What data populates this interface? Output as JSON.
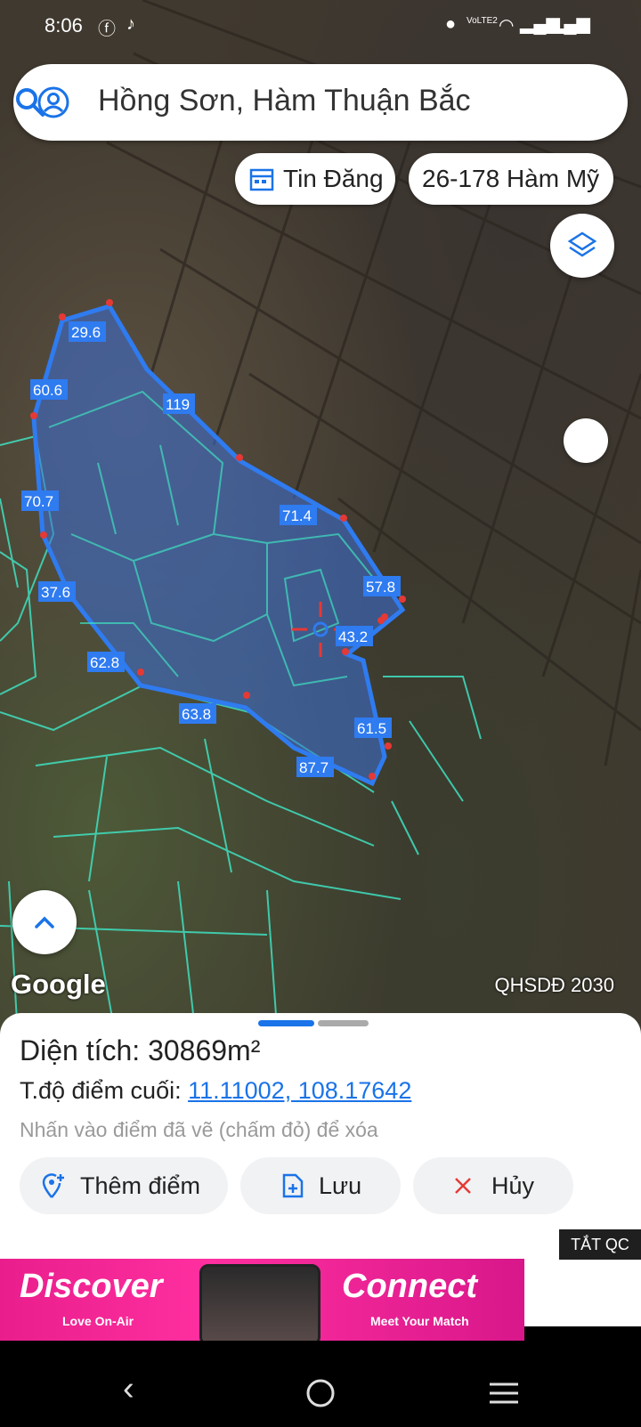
{
  "status": {
    "time": "8:06",
    "icons": [
      "facebook-icon",
      "tiktok-icon",
      "location-icon",
      "lte-icon",
      "wifi-icon",
      "signal-icon",
      "signal-icon",
      "battery-icon"
    ],
    "lte_label": "VoLTE2"
  },
  "search": {
    "text": "Hồng Sơn, Hàm Thuận Bắc",
    "left_icon": "account-icon",
    "right_icon": "search-icon"
  },
  "chips": {
    "tin_dang": "Tin Đăng",
    "address": "26-178 Hàm Mỹ"
  },
  "map": {
    "google": "Google",
    "plan_label": "QHSDĐ 2030",
    "edge_labels": [
      "29.6",
      "119",
      "60.6",
      "70.7",
      "71.4",
      "57.8",
      "43.2",
      "37.6",
      "62.8",
      "63.8",
      "61.5",
      "87.7"
    ],
    "colors": {
      "polygon_fill": "#3a6fd8",
      "polygon_stroke": "#2f7bf0",
      "parcel_lines": "#3fe0c0",
      "marker": "#e53935",
      "label_bg": "#2f7bf0"
    }
  },
  "sheet": {
    "area": "Diện tích: 30869m²",
    "endpoint_label": "T.độ điểm cuối: ",
    "endpoint_coords": "11.11002, 108.17642",
    "hint": "Nhấn vào điểm đã vẽ (chấm đỏ) để xóa",
    "add_point": "Thêm điểm",
    "save": "Lưu",
    "cancel": "Hủy"
  },
  "ad": {
    "close_label": "TẮT QC",
    "left_big": "Discover",
    "left_small": "Love On-Air",
    "right_big": "Connect",
    "right_small": "Meet Your Match"
  }
}
